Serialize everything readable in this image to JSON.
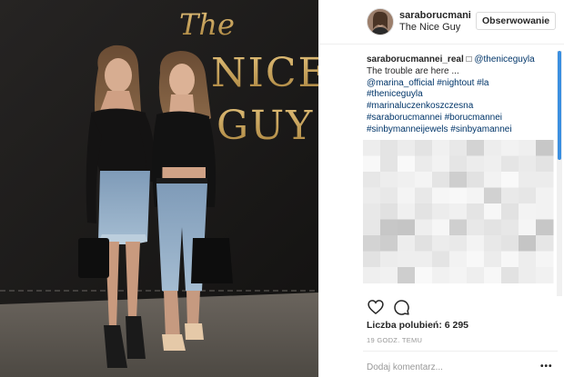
{
  "photo": {
    "sign_line1": "The",
    "sign_line2": "NICE",
    "sign_line3": "GUY"
  },
  "header": {
    "username": "saraborucmani",
    "location": "The Nice Guy",
    "follow_label": "Obserwowanie"
  },
  "caption": {
    "username": "saraborucmannei_real",
    "mention_icon": "□",
    "lines": [
      "@theniceguyla",
      "The trouble are here ...",
      "@marina_official #nightout #la",
      "#theniceguyla",
      "#marinaluczenkoszczesna",
      "#saraborucmannei #borucmannei",
      "#sinbymanneijewels #sinbyamannei"
    ]
  },
  "actions": {
    "like_icon": "heart-icon",
    "comment_icon": "comment-bubble-icon"
  },
  "likes_text": "Liczba polubień: 6 295",
  "time_text": "19 GODZ. TEMU",
  "comment": {
    "placeholder": "Dodaj komentarz...",
    "more_label": "•••"
  },
  "colors": {
    "link": "#003569",
    "muted": "#999999",
    "sign_gold": "#c9a45a",
    "scroll_thumb": "#3b8fe0"
  }
}
